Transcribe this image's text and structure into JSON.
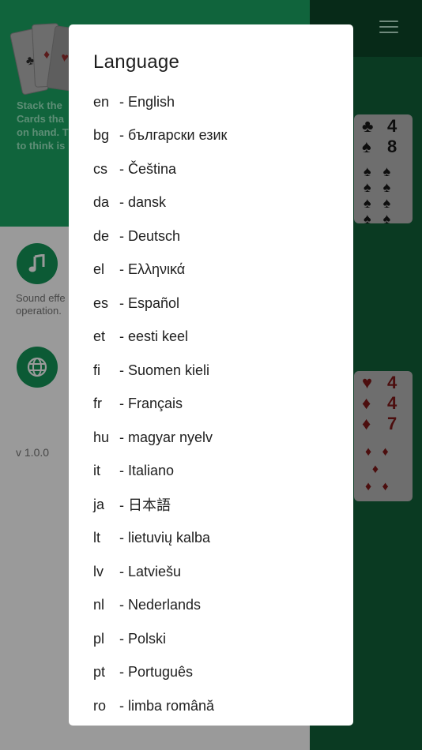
{
  "background": {
    "description_text": "Stack the\nCards tha\non hand. T\nto think is",
    "sound_text": "Sound effe\noperation.",
    "version": "v 1.0.0",
    "card_clubs_ranks": [
      "4",
      "8"
    ],
    "card_hearts_ranks": [
      "4",
      "4",
      "7"
    ]
  },
  "dialog": {
    "title": "Language",
    "languages": [
      {
        "code": "en",
        "name": "- English"
      },
      {
        "code": "bg",
        "name": "- български език"
      },
      {
        "code": "cs",
        "name": "- Čeština"
      },
      {
        "code": "da",
        "name": "- dansk"
      },
      {
        "code": "de",
        "name": "- Deutsch"
      },
      {
        "code": "el",
        "name": "- Ελληνικά"
      },
      {
        "code": "es",
        "name": "- Español"
      },
      {
        "code": "et",
        "name": "- eesti keel"
      },
      {
        "code": "fi",
        "name": "- Suomen kieli"
      },
      {
        "code": "fr",
        "name": "- Français"
      },
      {
        "code": "hu",
        "name": "- magyar nyelv"
      },
      {
        "code": "it",
        "name": "- Italiano"
      },
      {
        "code": "ja",
        "name": "- 日本語"
      },
      {
        "code": "lt",
        "name": "- lietuvių kalba"
      },
      {
        "code": "lv",
        "name": "- Latviešu"
      },
      {
        "code": "nl",
        "name": "- Nederlands"
      },
      {
        "code": "pl",
        "name": "- Polski"
      },
      {
        "code": "pt",
        "name": "- Português"
      },
      {
        "code": "ro",
        "name": "- limba română"
      }
    ]
  },
  "icons": {
    "menu": "hamburger-menu-icon",
    "music": "music-note-icon",
    "globe": "globe-icon"
  },
  "colors": {
    "green_header": "#10643c",
    "dark_green": "#0a3a22",
    "dialog_bg": "#ffffff"
  }
}
